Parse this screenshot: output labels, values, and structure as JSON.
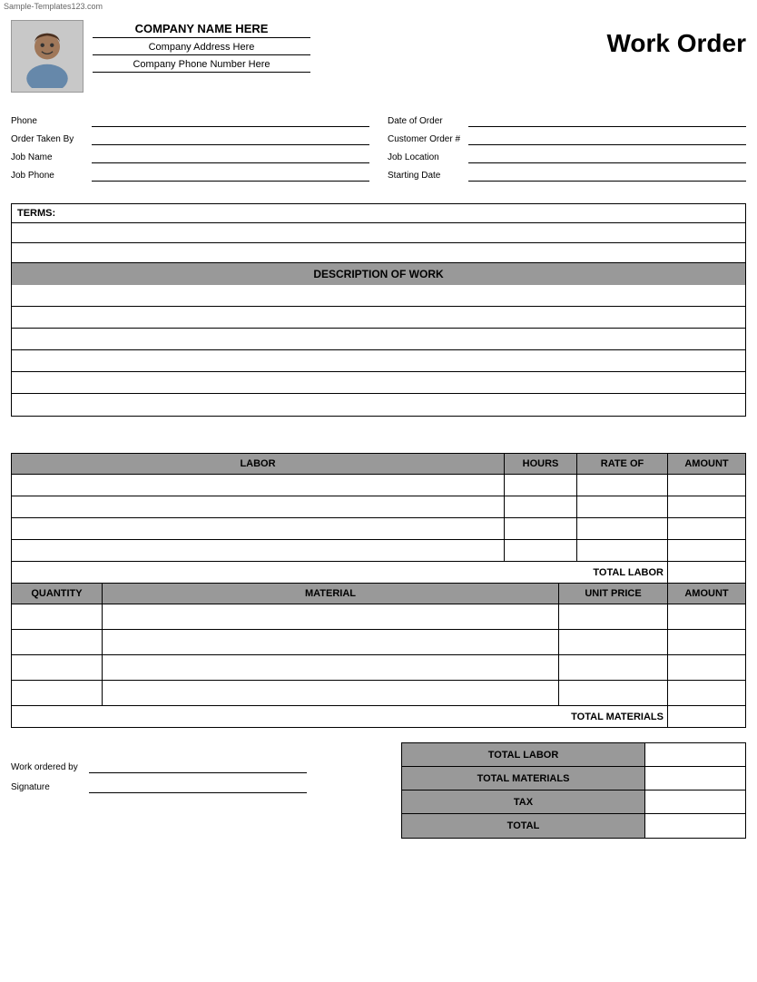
{
  "watermark": "Sample-Templates123.com",
  "header": {
    "company_name": "COMPANY NAME HERE",
    "company_address": "Company Address Here",
    "company_phone": "Company Phone Number Here",
    "title": "Work Order"
  },
  "form": {
    "phone_label": "Phone",
    "date_of_order_label": "Date of Order",
    "order_taken_by_label": "Order Taken By",
    "customer_order_label": "Customer Order #",
    "job_name_label": "Job Name",
    "job_location_label": "Job Location",
    "job_phone_label": "Job Phone",
    "starting_date_label": "Starting Date"
  },
  "terms": {
    "label": "TERMS:"
  },
  "description": {
    "header": "DESCRIPTION OF WORK",
    "rows": 6
  },
  "labor": {
    "columns": [
      "LABOR",
      "HOURS",
      "RATE OF",
      "AMOUNT"
    ],
    "rows": 4,
    "total_label": "TOTAL LABOR"
  },
  "materials": {
    "columns": [
      "QUANTITY",
      "MATERIAL",
      "UNIT PRICE",
      "AMOUNT"
    ],
    "rows": 4,
    "total_label": "TOTAL MATERIALS"
  },
  "summary": {
    "rows": [
      {
        "label": "TOTAL LABOR",
        "value": ""
      },
      {
        "label": "TOTAL MATERIALS",
        "value": ""
      },
      {
        "label": "TAX",
        "value": ""
      },
      {
        "label": "TOTAL",
        "value": ""
      }
    ]
  },
  "bottom": {
    "work_ordered_by_label": "Work ordered by",
    "signature_label": "Signature"
  }
}
